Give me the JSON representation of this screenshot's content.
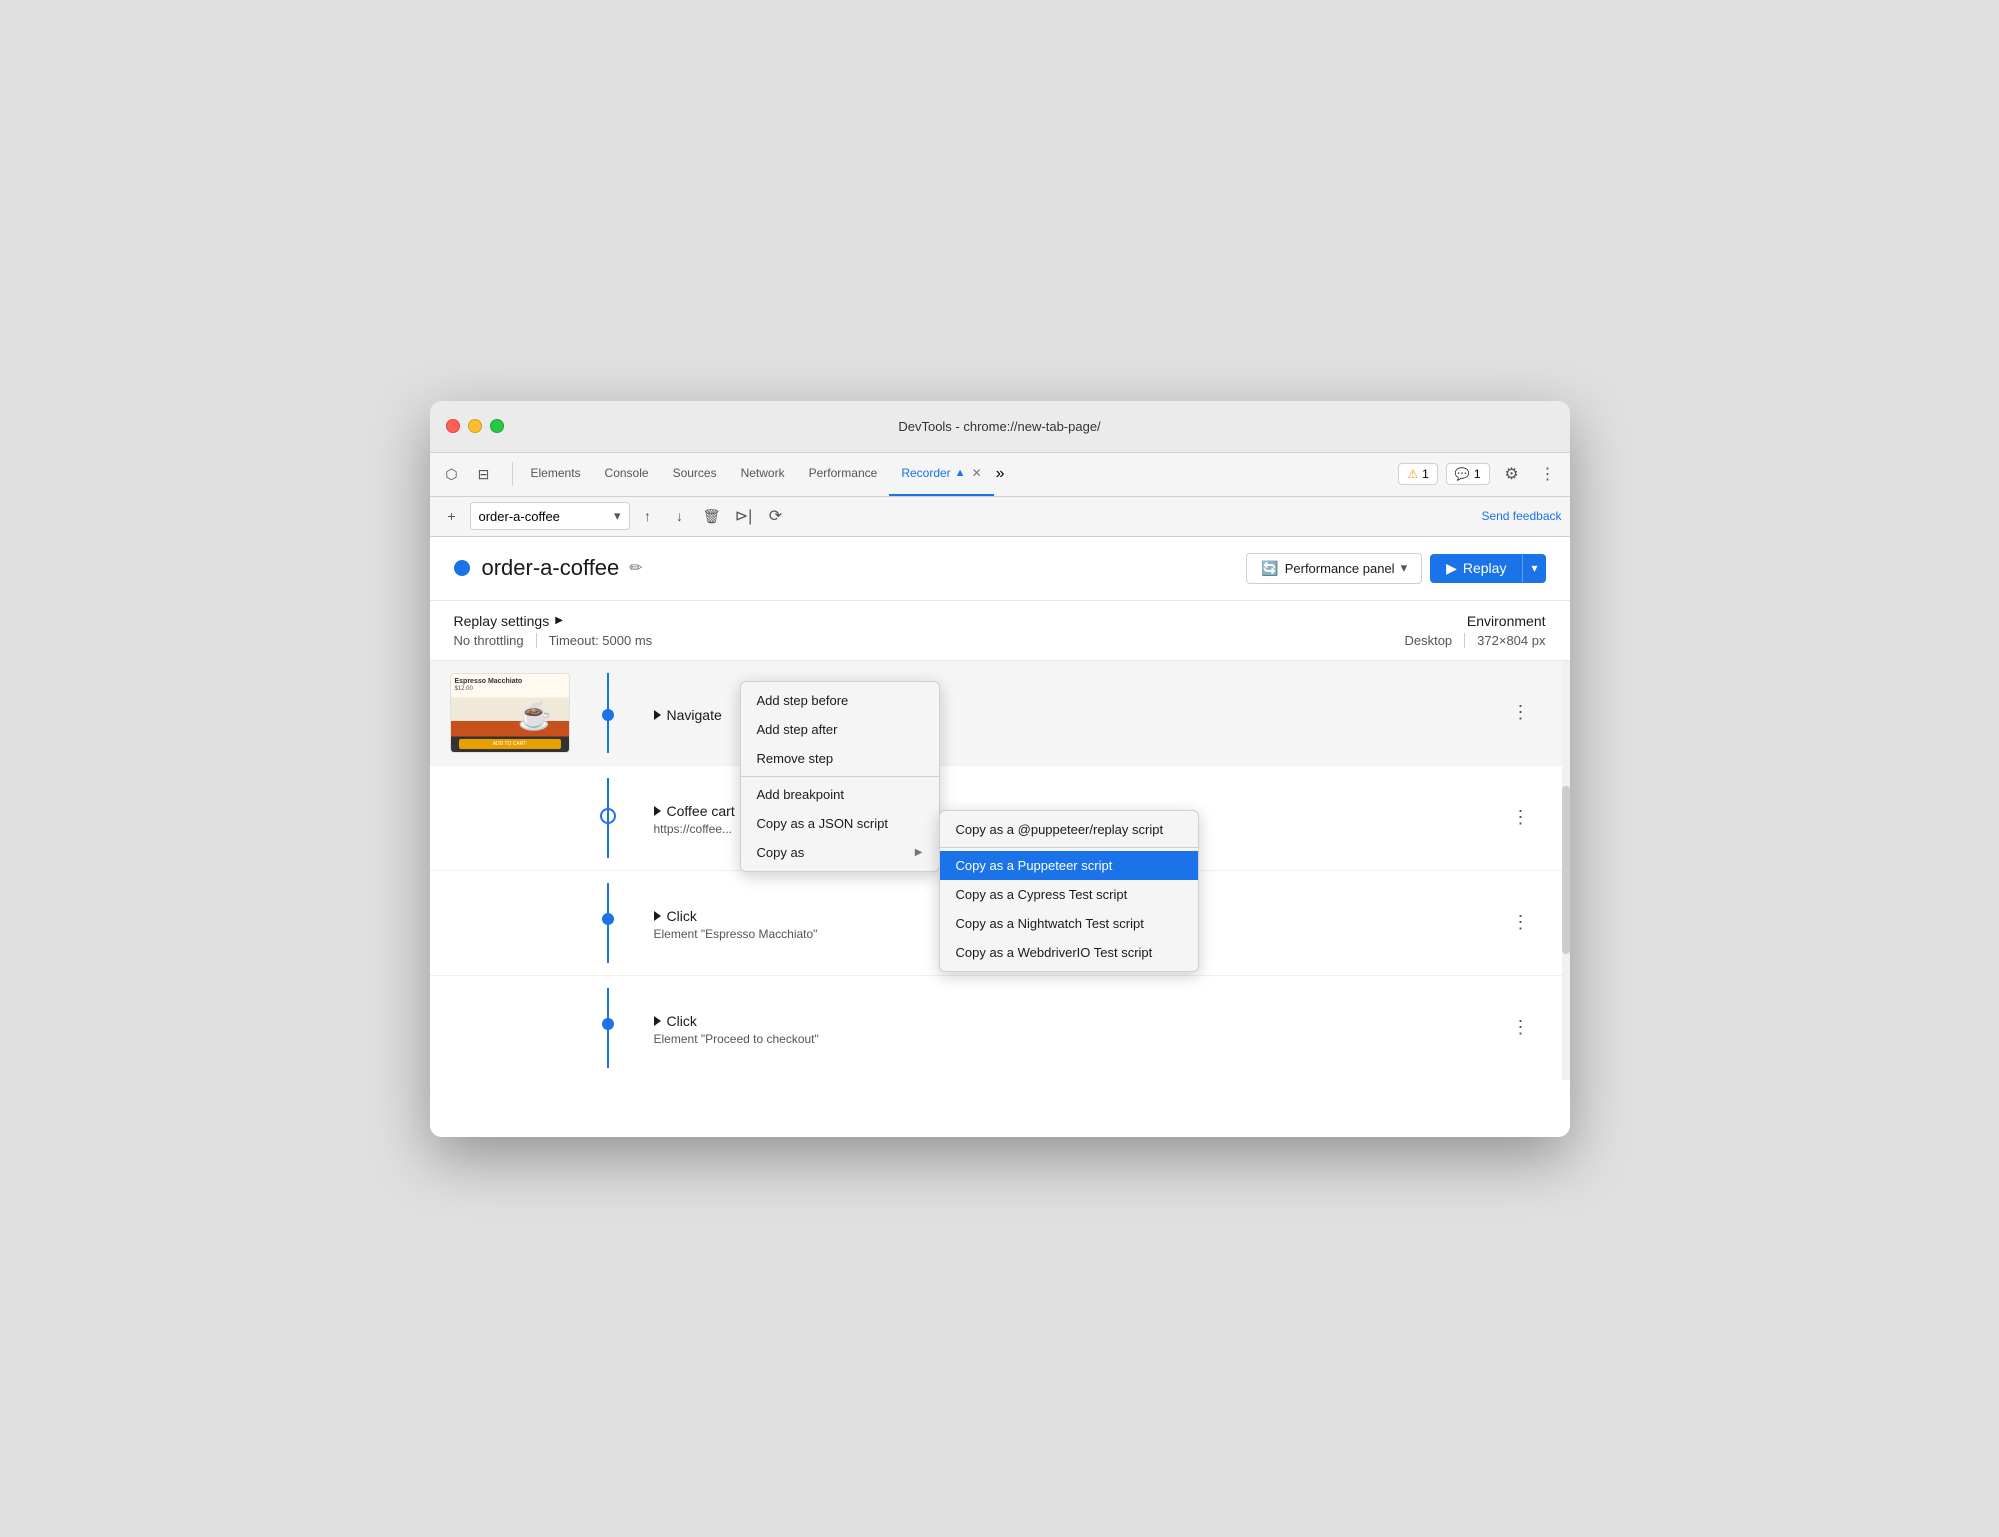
{
  "window": {
    "title": "DevTools - chrome://new-tab-page/"
  },
  "tabs": {
    "items": [
      {
        "label": "Elements",
        "active": false
      },
      {
        "label": "Console",
        "active": false
      },
      {
        "label": "Sources",
        "active": false
      },
      {
        "label": "Network",
        "active": false
      },
      {
        "label": "Performance",
        "active": false
      },
      {
        "label": "Recorder",
        "active": true
      }
    ],
    "more_label": "»",
    "warning_badge": "⚠ 1",
    "chat_badge": "💬 1"
  },
  "toolbar": {
    "new_recording_label": "+",
    "recording_name": "order-a-coffee",
    "send_feedback_label": "Send feedback"
  },
  "recording": {
    "title": "order-a-coffee",
    "dot_color": "#1a73e8",
    "perf_panel_label": "Performance panel",
    "replay_label": "Replay"
  },
  "settings": {
    "title": "Replay settings",
    "throttling": "No throttling",
    "timeout": "Timeout: 5000 ms",
    "env_title": "Environment",
    "desktop": "Desktop",
    "resolution": "372×804 px"
  },
  "steps": [
    {
      "type": "navigate",
      "label": "Navigate",
      "has_thumb": true,
      "dot": "solid"
    },
    {
      "type": "coffee_cart",
      "label": "Coffee cart",
      "detail": "https://coffee...",
      "has_thumb": false,
      "dot": "outline"
    },
    {
      "type": "click",
      "label": "Click",
      "detail": "Element \"Espresso Macchiato\"",
      "has_thumb": false,
      "dot": "solid"
    },
    {
      "type": "click2",
      "label": "Click",
      "detail": "Element \"Proceed to checkout\"",
      "has_thumb": false,
      "dot": "solid"
    }
  ],
  "context_menu": {
    "items": [
      {
        "label": "Add step before",
        "active": false,
        "has_divider_after": false
      },
      {
        "label": "Add step after",
        "active": false,
        "has_divider_after": false
      },
      {
        "label": "Remove step",
        "active": false,
        "has_divider_after": true
      },
      {
        "label": "Add breakpoint",
        "active": false,
        "has_divider_after": false
      },
      {
        "label": "Copy as a JSON script",
        "active": false,
        "has_divider_after": false
      },
      {
        "label": "Copy as",
        "active": false,
        "has_submenu": true,
        "has_divider_after": false
      }
    ]
  },
  "submenu": {
    "items": [
      {
        "label": "Copy as a @puppeteer/replay script",
        "active": false,
        "has_divider_after": true
      },
      {
        "label": "Copy as a Puppeteer script",
        "active": true,
        "has_divider_after": false
      },
      {
        "label": "Copy as a Cypress Test script",
        "active": false,
        "has_divider_after": false
      },
      {
        "label": "Copy as a Nightwatch Test script",
        "active": false,
        "has_divider_after": false
      },
      {
        "label": "Copy as a WebdriverIO Test script",
        "active": false,
        "has_divider_after": false
      }
    ]
  }
}
